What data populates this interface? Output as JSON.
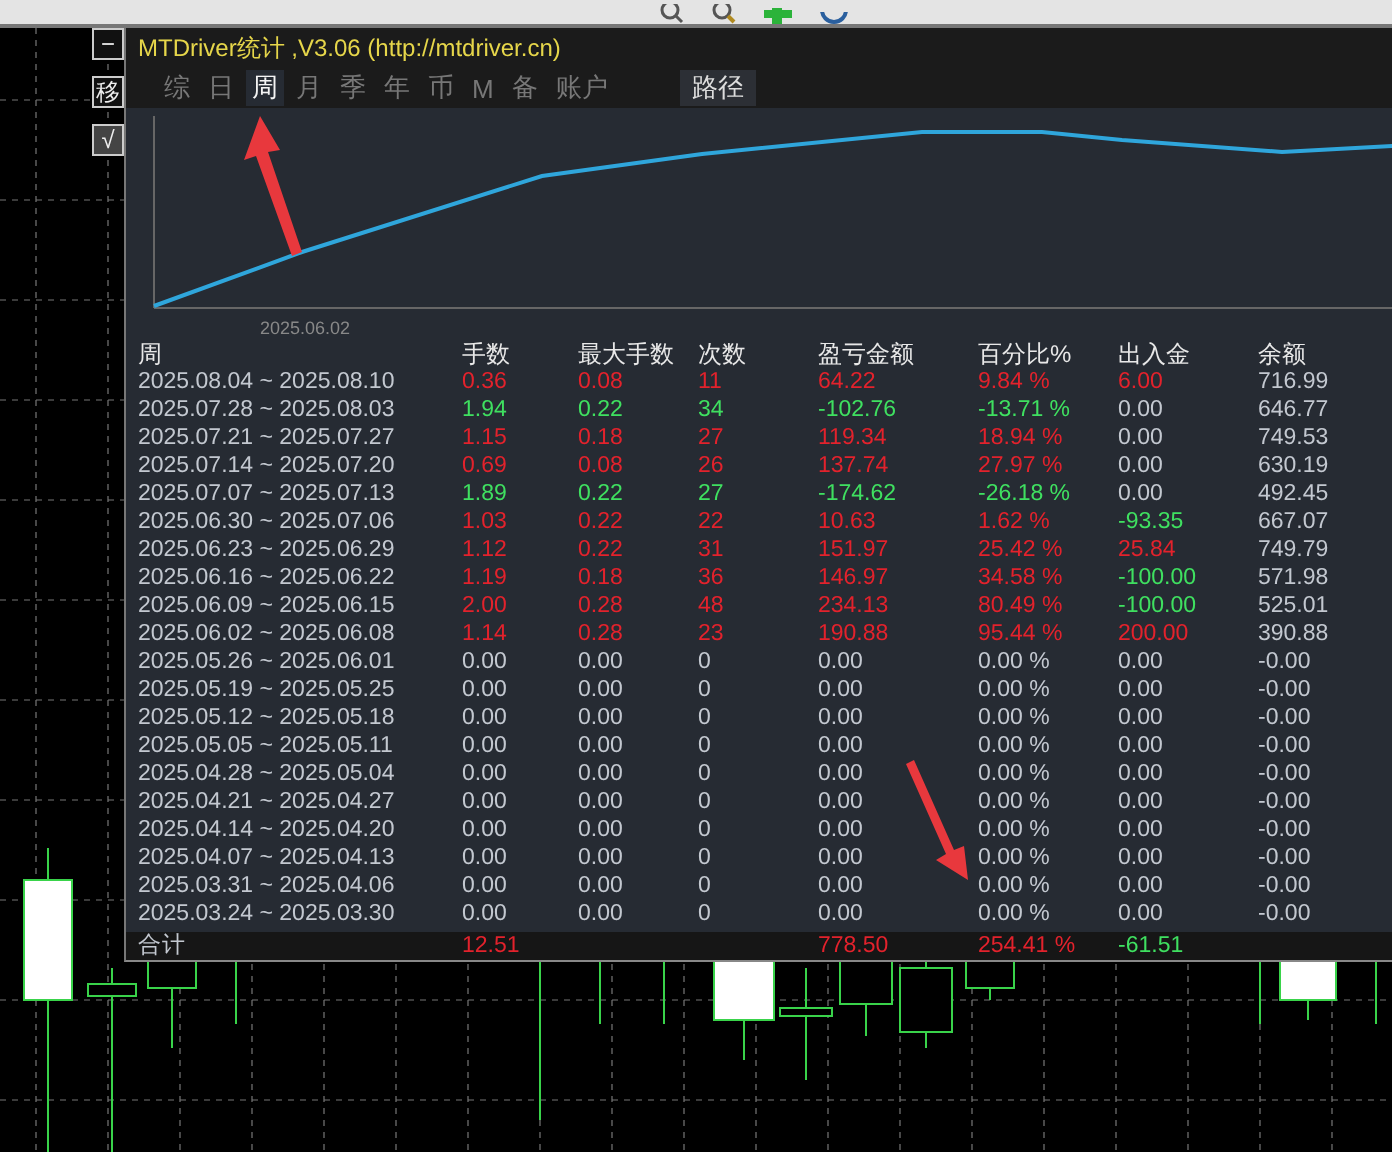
{
  "side_buttons": [
    "−",
    "移",
    "√"
  ],
  "panel": {
    "title": "MTDriver统计 ,V3.06 (http://mtdriver.cn)",
    "tabs": [
      {
        "label": "综",
        "selected": false
      },
      {
        "label": "日",
        "selected": false
      },
      {
        "label": "周",
        "selected": true
      },
      {
        "label": "月",
        "selected": false
      },
      {
        "label": "季",
        "selected": false
      },
      {
        "label": "年",
        "selected": false
      },
      {
        "label": "币",
        "selected": false
      },
      {
        "label": "M",
        "selected": false
      },
      {
        "label": "备",
        "selected": false
      },
      {
        "label": "账户",
        "selected": false
      }
    ],
    "path_button": "路径",
    "chart_x_label": "2025.06.02",
    "table": {
      "columns": [
        "周",
        "手数",
        "最大手数",
        "次数",
        "盈亏金额",
        "百分比%",
        "出入金",
        "余额"
      ],
      "rows": [
        {
          "period": "2025.08.04 ~ 2025.08.10",
          "color": "#e3222c",
          "lots": "0.36",
          "max_lots": "0.08",
          "count": "11",
          "pnl": "64.22",
          "pct": "9.84 %",
          "flow": {
            "text": "6.00",
            "color": "#e3222c"
          },
          "balance": "716.99"
        },
        {
          "period": "2025.07.28 ~ 2025.08.03",
          "color": "#3fe060",
          "lots": "1.94",
          "max_lots": "0.22",
          "count": "34",
          "pnl": "-102.76",
          "pct": "-13.71 %",
          "flow": {
            "text": "0.00",
            "color": "#c3c8d0"
          },
          "balance": "646.77"
        },
        {
          "period": "2025.07.21 ~ 2025.07.27",
          "color": "#e3222c",
          "lots": "1.15",
          "max_lots": "0.18",
          "count": "27",
          "pnl": "119.34",
          "pct": "18.94 %",
          "flow": {
            "text": "0.00",
            "color": "#c3c8d0"
          },
          "balance": "749.53"
        },
        {
          "period": "2025.07.14 ~ 2025.07.20",
          "color": "#e3222c",
          "lots": "0.69",
          "max_lots": "0.08",
          "count": "26",
          "pnl": "137.74",
          "pct": "27.97 %",
          "flow": {
            "text": "0.00",
            "color": "#c3c8d0"
          },
          "balance": "630.19"
        },
        {
          "period": "2025.07.07 ~ 2025.07.13",
          "color": "#3fe060",
          "lots": "1.89",
          "max_lots": "0.22",
          "count": "27",
          "pnl": "-174.62",
          "pct": "-26.18 %",
          "flow": {
            "text": "0.00",
            "color": "#c3c8d0"
          },
          "balance": "492.45"
        },
        {
          "period": "2025.06.30 ~ 2025.07.06",
          "color": "#e3222c",
          "lots": "1.03",
          "max_lots": "0.22",
          "count": "22",
          "pnl": "10.63",
          "pct": "1.62 %",
          "flow": {
            "text": "-93.35",
            "color": "#3fe060"
          },
          "balance": "667.07"
        },
        {
          "period": "2025.06.23 ~ 2025.06.29",
          "color": "#e3222c",
          "lots": "1.12",
          "max_lots": "0.22",
          "count": "31",
          "pnl": "151.97",
          "pct": "25.42 %",
          "flow": {
            "text": "25.84",
            "color": "#e3222c"
          },
          "balance": "749.79"
        },
        {
          "period": "2025.06.16 ~ 2025.06.22",
          "color": "#e3222c",
          "lots": "1.19",
          "max_lots": "0.18",
          "count": "36",
          "pnl": "146.97",
          "pct": "34.58 %",
          "flow": {
            "text": "-100.00",
            "color": "#3fe060"
          },
          "balance": "571.98"
        },
        {
          "period": "2025.06.09 ~ 2025.06.15",
          "color": "#e3222c",
          "lots": "2.00",
          "max_lots": "0.28",
          "count": "48",
          "pnl": "234.13",
          "pct": "80.49 %",
          "flow": {
            "text": "-100.00",
            "color": "#3fe060"
          },
          "balance": "525.01"
        },
        {
          "period": "2025.06.02 ~ 2025.06.08",
          "color": "#e3222c",
          "lots": "1.14",
          "max_lots": "0.28",
          "count": "23",
          "pnl": "190.88",
          "pct": "95.44 %",
          "flow": {
            "text": "200.00",
            "color": "#e3222c"
          },
          "balance": "390.88"
        },
        {
          "period": "2025.05.26 ~ 2025.06.01",
          "color": "#c3c8d0",
          "lots": "0.00",
          "max_lots": "0.00",
          "count": "0",
          "pnl": "0.00",
          "pct": "0.00 %",
          "flow": {
            "text": "0.00",
            "color": "#c3c8d0"
          },
          "balance": "-0.00"
        },
        {
          "period": "2025.05.19 ~ 2025.05.25",
          "color": "#c3c8d0",
          "lots": "0.00",
          "max_lots": "0.00",
          "count": "0",
          "pnl": "0.00",
          "pct": "0.00 %",
          "flow": {
            "text": "0.00",
            "color": "#c3c8d0"
          },
          "balance": "-0.00"
        },
        {
          "period": "2025.05.12 ~ 2025.05.18",
          "color": "#c3c8d0",
          "lots": "0.00",
          "max_lots": "0.00",
          "count": "0",
          "pnl": "0.00",
          "pct": "0.00 %",
          "flow": {
            "text": "0.00",
            "color": "#c3c8d0"
          },
          "balance": "-0.00"
        },
        {
          "period": "2025.05.05 ~ 2025.05.11",
          "color": "#c3c8d0",
          "lots": "0.00",
          "max_lots": "0.00",
          "count": "0",
          "pnl": "0.00",
          "pct": "0.00 %",
          "flow": {
            "text": "0.00",
            "color": "#c3c8d0"
          },
          "balance": "-0.00"
        },
        {
          "period": "2025.04.28 ~ 2025.05.04",
          "color": "#c3c8d0",
          "lots": "0.00",
          "max_lots": "0.00",
          "count": "0",
          "pnl": "0.00",
          "pct": "0.00 %",
          "flow": {
            "text": "0.00",
            "color": "#c3c8d0"
          },
          "balance": "-0.00"
        },
        {
          "period": "2025.04.21 ~ 2025.04.27",
          "color": "#c3c8d0",
          "lots": "0.00",
          "max_lots": "0.00",
          "count": "0",
          "pnl": "0.00",
          "pct": "0.00 %",
          "flow": {
            "text": "0.00",
            "color": "#c3c8d0"
          },
          "balance": "-0.00"
        },
        {
          "period": "2025.04.14 ~ 2025.04.20",
          "color": "#c3c8d0",
          "lots": "0.00",
          "max_lots": "0.00",
          "count": "0",
          "pnl": "0.00",
          "pct": "0.00 %",
          "flow": {
            "text": "0.00",
            "color": "#c3c8d0"
          },
          "balance": "-0.00"
        },
        {
          "period": "2025.04.07 ~ 2025.04.13",
          "color": "#c3c8d0",
          "lots": "0.00",
          "max_lots": "0.00",
          "count": "0",
          "pnl": "0.00",
          "pct": "0.00 %",
          "flow": {
            "text": "0.00",
            "color": "#c3c8d0"
          },
          "balance": "-0.00"
        },
        {
          "period": "2025.03.31 ~ 2025.04.06",
          "color": "#c3c8d0",
          "lots": "0.00",
          "max_lots": "0.00",
          "count": "0",
          "pnl": "0.00",
          "pct": "0.00 %",
          "flow": {
            "text": "0.00",
            "color": "#c3c8d0"
          },
          "balance": "-0.00"
        },
        {
          "period": "2025.03.24 ~ 2025.03.30",
          "color": "#c3c8d0",
          "lots": "0.00",
          "max_lots": "0.00",
          "count": "0",
          "pnl": "0.00",
          "pct": "0.00 %",
          "flow": {
            "text": "0.00",
            "color": "#c3c8d0"
          },
          "balance": "-0.00"
        }
      ],
      "total": {
        "label": "合计",
        "color": "#e3222c",
        "lots": "12.51",
        "pnl": "778.50",
        "pct": "254.41 %",
        "flow": {
          "text": "-61.51",
          "color": "#3fe060"
        }
      }
    }
  }
}
